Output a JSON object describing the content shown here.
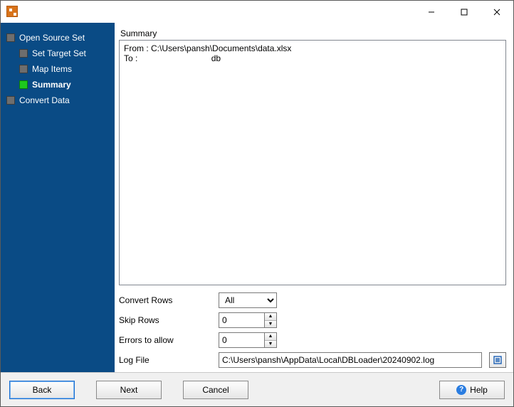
{
  "window": {
    "title": ""
  },
  "sidebar": {
    "items": [
      {
        "label": "Open Source Set",
        "active": false,
        "children": [
          {
            "label": "Set Target Set",
            "active": false
          },
          {
            "label": "Map Items",
            "active": false
          },
          {
            "label": "Summary",
            "active": true
          }
        ]
      },
      {
        "label": "Convert Data",
        "active": false
      }
    ]
  },
  "main": {
    "section_title": "Summary",
    "summary": {
      "from_label": "From :",
      "from_value": "C:\\Users\\pansh\\Documents\\data.xlsx",
      "to_label": "To :",
      "to_value": "db"
    },
    "form": {
      "convert_rows_label": "Convert Rows",
      "convert_rows_value": "All",
      "convert_rows_options": [
        "All"
      ],
      "skip_rows_label": "Skip Rows",
      "skip_rows_value": "0",
      "errors_label": "Errors to allow",
      "errors_value": "0",
      "logfile_label": "Log File",
      "logfile_value": "C:\\Users\\pansh\\AppData\\Local\\DBLoader\\20240902.log"
    }
  },
  "footer": {
    "back_label": "Back",
    "next_label": "Next",
    "cancel_label": "Cancel",
    "help_label": "Help"
  }
}
